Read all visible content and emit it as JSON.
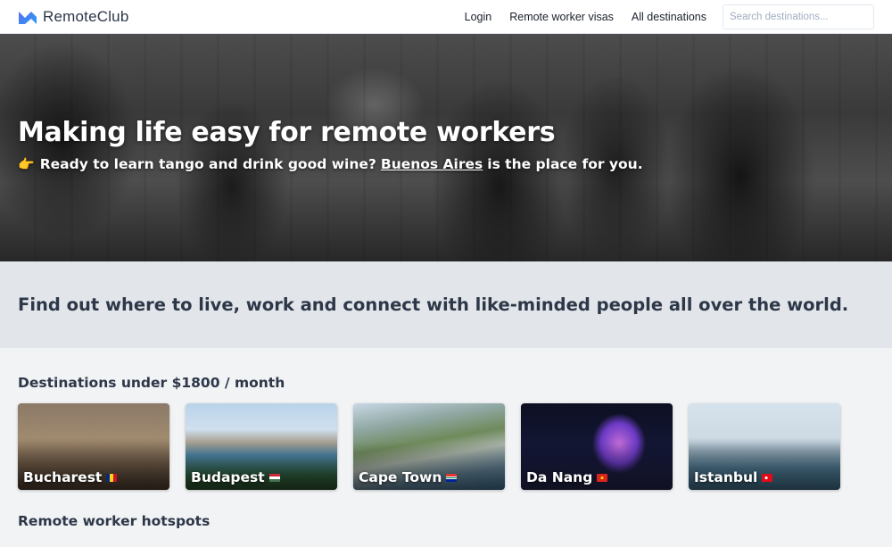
{
  "header": {
    "brand": "RemoteClub",
    "nav": [
      {
        "label": "Login"
      },
      {
        "label": "Remote worker visas"
      },
      {
        "label": "All destinations"
      }
    ],
    "search_placeholder": "Search destinations..."
  },
  "hero": {
    "title": "Making life easy for remote workers",
    "emoji": "👉",
    "subtitle_before": "Ready to learn tango and drink good wine?",
    "subtitle_link": "Buenos Aires",
    "subtitle_after": "is the place for you."
  },
  "tagline": "Find out where to live, work and connect with like-minded people all over the world.",
  "destinations": {
    "title": "Destinations under $1800 / month",
    "cards": [
      {
        "name": "Bucharest",
        "flag": "romania-flag-icon"
      },
      {
        "name": "Budapest",
        "flag": "hungary-flag-icon"
      },
      {
        "name": "Cape Town",
        "flag": "south-africa-flag-icon"
      },
      {
        "name": "Da Nang",
        "flag": "vietnam-flag-icon"
      },
      {
        "name": "Istanbul",
        "flag": "turkey-flag-icon"
      }
    ]
  },
  "hotspots": {
    "title": "Remote worker hotspots"
  },
  "colors": {
    "brand_gradient_start": "#5b6cf0",
    "brand_gradient_end": "#2b9cf4",
    "background": "#f1f3f5",
    "tagline_band": "#e2e5e9",
    "text": "#2d3748"
  }
}
